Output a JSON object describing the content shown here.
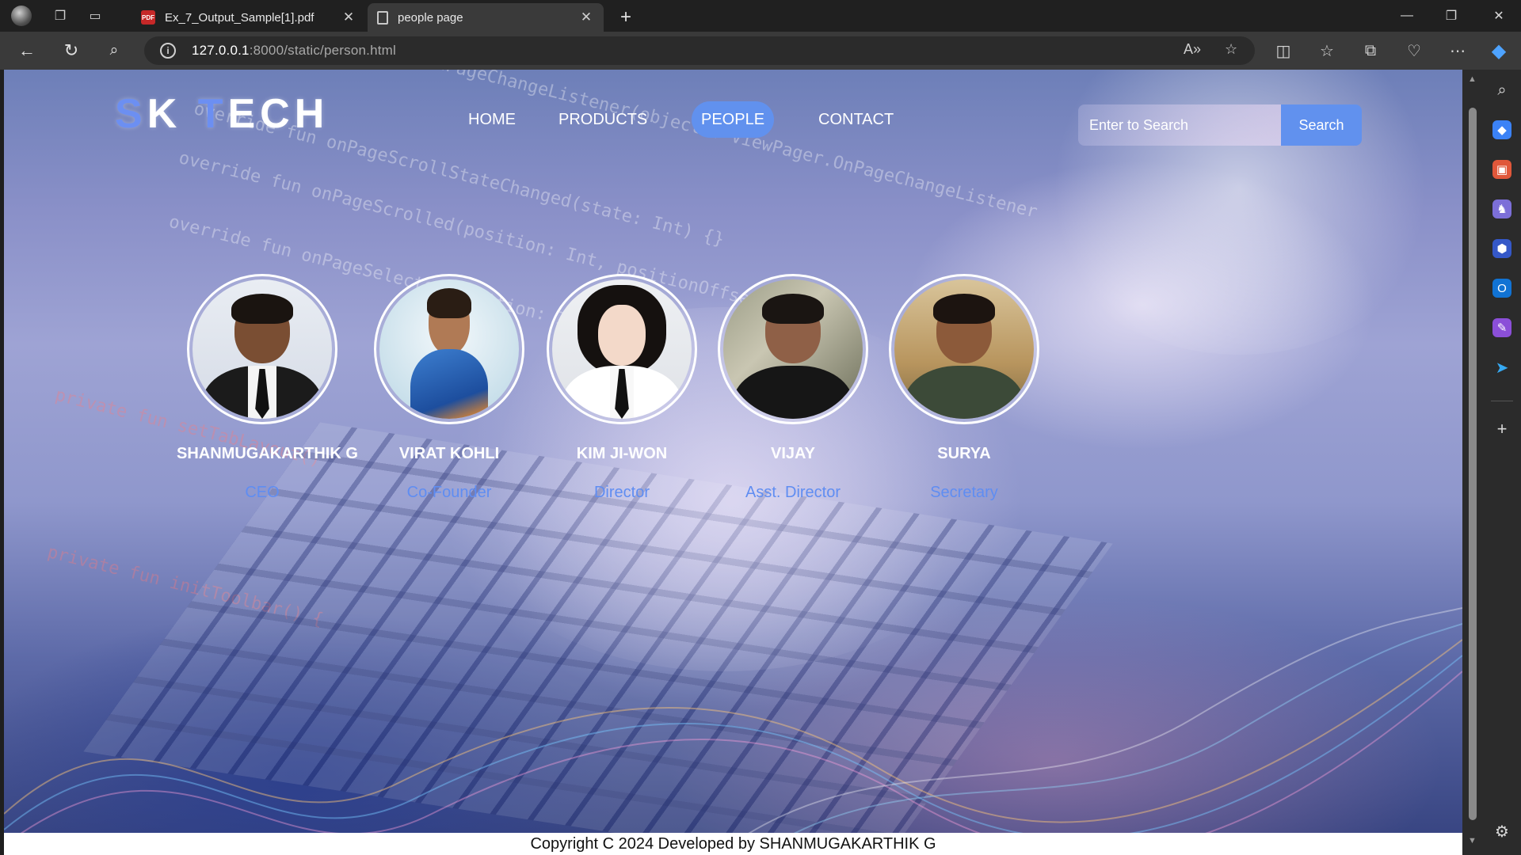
{
  "browser": {
    "tabs": [
      {
        "title": "Ex_7_Output_Sample[1].pdf",
        "favicon": "pdf-icon",
        "favicon_text": "PDF",
        "active": false
      },
      {
        "title": "people page",
        "favicon": "page-icon",
        "active": true
      }
    ],
    "url_host": "127.0.0.1",
    "url_rest": ":8000/static/person.html"
  },
  "site": {
    "logo_part1": "S",
    "logo_part2": "K ",
    "logo_part3": "T",
    "logo_part4": "ECH",
    "accent_color": "#6c8ff2",
    "nav": [
      {
        "label": "HOME",
        "active": false
      },
      {
        "label": "PRODUCTS",
        "active": false
      },
      {
        "label": "PEOPLE",
        "active": true
      },
      {
        "label": "CONTACT",
        "active": false
      }
    ],
    "search_placeholder": "Enter to Search",
    "search_button": "Search"
  },
  "people": [
    {
      "name": "SHANMUGAKARTHIK G",
      "role": "CEO"
    },
    {
      "name": "VIRAT KOHLI",
      "role": "Co-Founder"
    },
    {
      "name": "KIM JI-WON",
      "role": "Director"
    },
    {
      "name": "VIJAY",
      "role": "Asst. Director"
    },
    {
      "name": "SURYA",
      "role": "Secretary"
    }
  ],
  "footer": "Copyright C 2024 Developed by SHANMUGAKARTHIK G"
}
